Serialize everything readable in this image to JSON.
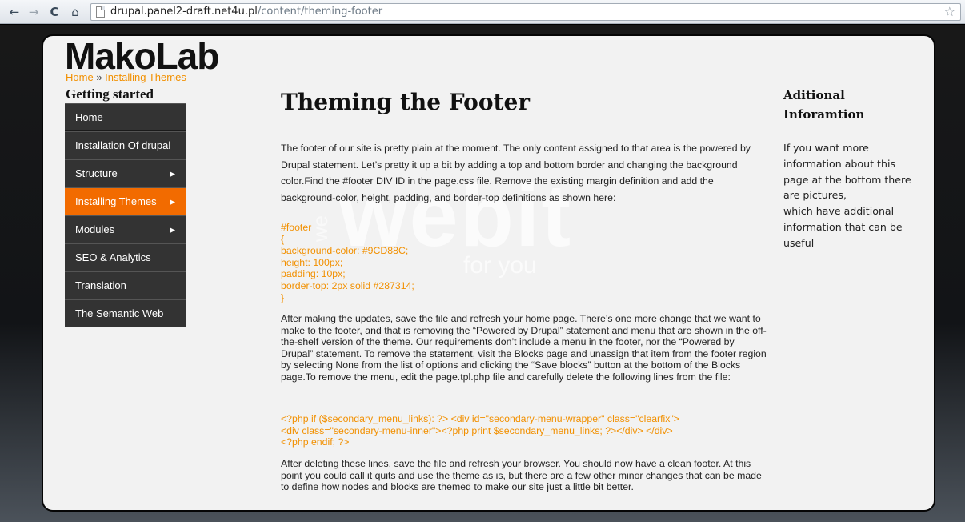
{
  "browser": {
    "back_icon": "←",
    "forward_icon": "→",
    "reload_icon": "C",
    "home_icon": "⌂",
    "url_host": "drupal.panel2-draft.net4u.pl",
    "url_path": "/content/theming-footer",
    "star_icon": "☆"
  },
  "site": {
    "logo": "MakoLab",
    "breadcrumb": {
      "home": "Home",
      "sep": "»",
      "current": "Installing Themes"
    },
    "watermark": {
      "we": "we",
      "big": "webit",
      "small": "for you"
    }
  },
  "sidebar": {
    "title": "Getting started",
    "items": [
      {
        "label": "Home",
        "arrow": ""
      },
      {
        "label": "Installation Of drupal",
        "arrow": ""
      },
      {
        "label": "Structure",
        "arrow": "▶"
      },
      {
        "label": "Installing Themes",
        "arrow": "▶"
      },
      {
        "label": "Modules",
        "arrow": "▶"
      },
      {
        "label": "SEO & Analytics",
        "arrow": ""
      },
      {
        "label": "Translation",
        "arrow": ""
      },
      {
        "label": "The Semantic Web",
        "arrow": ""
      }
    ]
  },
  "main": {
    "title": "Theming the Footer",
    "intro": "The footer of our site is pretty plain at the moment. The only content assigned to that area is the powered by Drupal statement. Let’s pretty it up a bit by adding a top and bottom border and changing the background color.Find the #footer DIV ID in the page.css file. Remove the existing margin definition and add the background-color, height, padding, and border-top definitions as shown here:",
    "code1": [
      "#footer",
      "{",
      "background-color: #9CD88C;",
      "height: 100px;",
      "padding: 10px;",
      "border-top: 2px solid #287314;",
      "}"
    ],
    "para2": "After making the updates, save the file and refresh your home page. There’s one more change that we want to make to the footer, and that is removing the “Powered by Drupal” statement and menu that are shown in the off-the-shelf version of the theme. Our requirements don’t include a menu in the footer, nor the “Powered by Drupal” statement. To remove the statement, visit the Blocks page and unassign that item from the footer region by selecting None from the list of options and clicking the “Save blocks” button at the bottom of the Blocks page.To remove the menu, edit the page.tpl.php file and carefully delete the following lines from the file:",
    "code2": [
      "<?php if ($secondary_menu_links): ?> <div id=\"secondary-menu-wrapper\" class=\"clearfix\">",
      "<div class=\"secondary-menu-inner\"><?php print $secondary_menu_links; ?></div> </div>",
      "<?php endif; ?>"
    ],
    "para3": "After deleting these lines, save the file and refresh your browser. You should now have a clean footer. At this point you could call it quits and use the theme as is, but there are a few other minor changes that can be made to define how nodes and blocks are themed to make our site just a little bit better."
  },
  "aside": {
    "title": "Aditional Inforamtion",
    "text_line1": "If you want more information about this page at the bottom there are pictures,",
    "text_line2": "which have additional information that can be useful"
  },
  "colors": {
    "accent": "#f29000",
    "active_menu": "#f26b00",
    "menu_bg": "#333333"
  }
}
